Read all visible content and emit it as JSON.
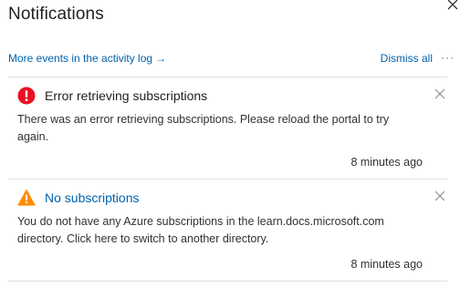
{
  "panel": {
    "title": "Notifications",
    "close_icon": "close-icon"
  },
  "toolbar": {
    "activity_link_label": "More events in the activity log",
    "activity_link_arrow": "→",
    "dismiss_all_label": "Dismiss all",
    "more_label": "···"
  },
  "notifications": [
    {
      "icon": "error-icon",
      "icon_color": "#e81123",
      "title": "Error retrieving subscriptions",
      "message": "There was an error retrieving subscriptions. Please reload the portal to try again.",
      "time": "8 minutes ago"
    },
    {
      "icon": "warning-icon",
      "icon_color": "#ff8c00",
      "title": "No subscriptions",
      "message": "You do not have any Azure subscriptions in the learn.docs.microsoft.com directory. Click here to switch to another directory.",
      "time": "8 minutes ago"
    }
  ],
  "colors": {
    "link": "#0062ad",
    "divider": "#e1dfdd"
  }
}
